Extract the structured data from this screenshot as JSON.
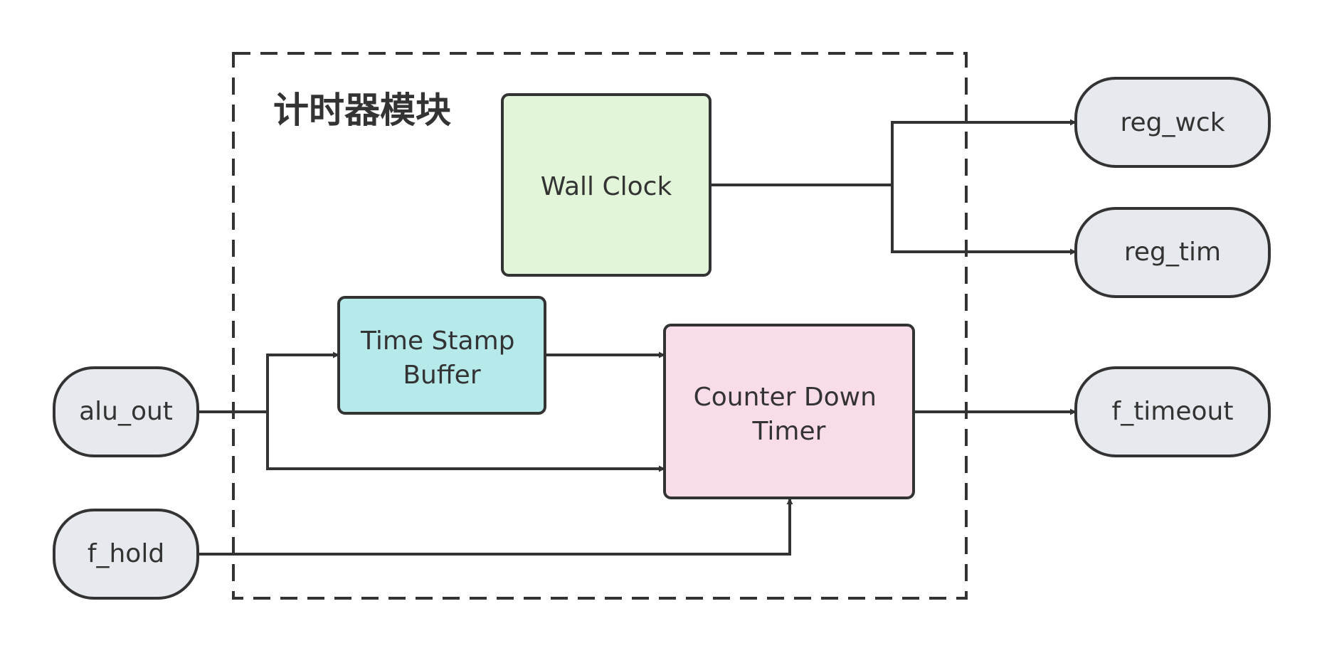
{
  "diagram": {
    "title": "计时器模块",
    "blocks": {
      "wall_clock": "Wall Clock",
      "time_stamp_buffer": [
        "Time Stamp",
        "Buffer"
      ],
      "counter_down_timer": [
        "Counter Down",
        "Timer"
      ]
    },
    "inputs": {
      "alu_out": "alu_out",
      "f_hold": "f_hold"
    },
    "outputs": {
      "reg_wck": "reg_wck",
      "reg_tim": "reg_tim",
      "f_timeout": "f_timeout"
    }
  },
  "colors": {
    "stroke": "#333333",
    "input_output_fill": "#e6e9ed",
    "wall_clock_fill": "#e3f5d9",
    "time_stamp_buffer_fill": "#b5e9ea",
    "counter_down_timer_fill": "#f9dcea"
  }
}
